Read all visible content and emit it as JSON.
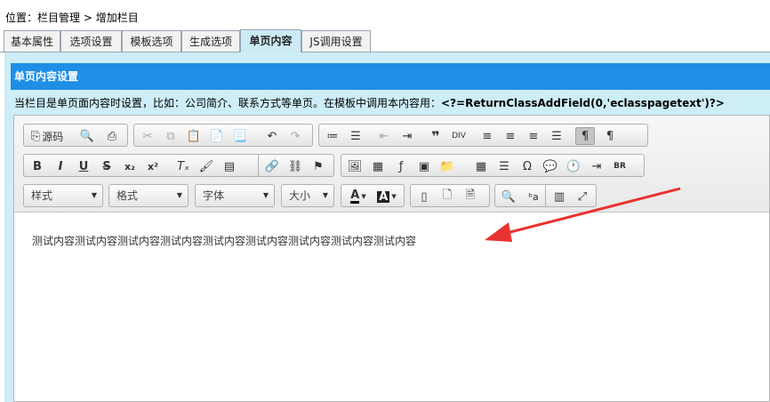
{
  "breadcrumb": {
    "prefix": "位置：",
    "link1": "栏目管理",
    "sep": " > ",
    "current": "增加栏目"
  },
  "tabs": [
    {
      "label": "基本属性"
    },
    {
      "label": "选项设置"
    },
    {
      "label": "模板选项"
    },
    {
      "label": "生成选项"
    },
    {
      "label": "单页内容",
      "active": true
    },
    {
      "label": "JS调用设置"
    }
  ],
  "section": {
    "title": "单页内容设置"
  },
  "notice": {
    "text": "当栏目是单页面内容时设置，比如：公司简介、联系方式等单页。在模板中调用本内容用：",
    "code": "<?=ReturnClassAddField(0,'eclasspagetext')?>"
  },
  "toolbar": {
    "source_label": "源码",
    "combos": {
      "style": "样式",
      "format": "格式",
      "font": "字体",
      "size": "大小"
    }
  },
  "editor": {
    "content": "测试内容测试内容测试内容测试内容测试内容测试内容测试内容测试内容测试内容"
  },
  "colors": {
    "accent": "#1e8ee6",
    "panel": "#cdedf7",
    "arrow": "#e8322f"
  }
}
